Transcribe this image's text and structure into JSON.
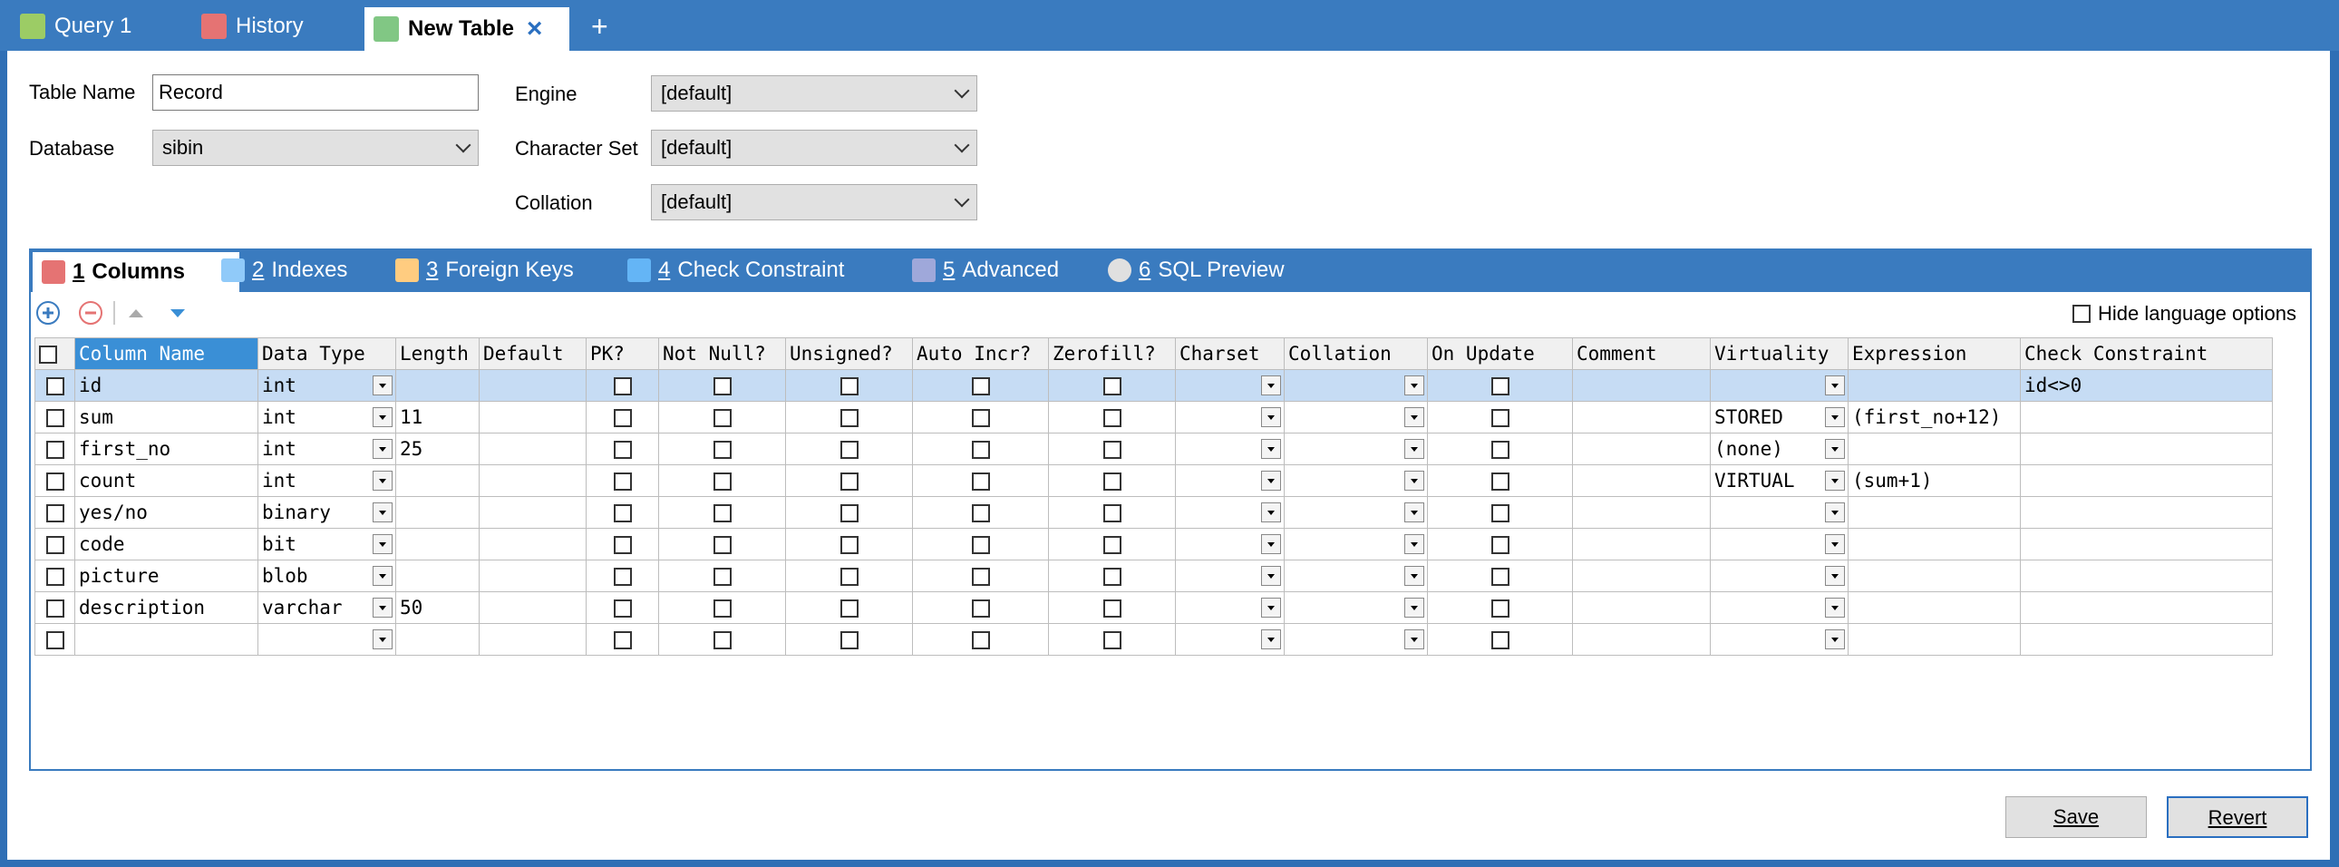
{
  "tabs": [
    {
      "label": "Query 1"
    },
    {
      "label": "History"
    },
    {
      "label": "New Table"
    }
  ],
  "add_tab_symbol": "+",
  "close_symbol": "×",
  "form": {
    "table_name_label": "Table Name",
    "table_name_value": "Record",
    "database_label": "Database",
    "database_value": "sibin",
    "engine_label": "Engine",
    "engine_value": "[default]",
    "charset_label": "Character Set",
    "charset_value": "[default]",
    "collation_label": "Collation",
    "collation_value": "[default]"
  },
  "inner_tabs": [
    {
      "num": "1",
      "label": "Columns"
    },
    {
      "num": "2",
      "label": "Indexes"
    },
    {
      "num": "3",
      "label": "Foreign Keys"
    },
    {
      "num": "4",
      "label": "Check Constraint"
    },
    {
      "num": "5",
      "label": "Advanced"
    },
    {
      "num": "6",
      "label": "SQL Preview"
    }
  ],
  "hide_language_label": "Hide language options",
  "headers": [
    "Column Name",
    "Data Type",
    "Length",
    "Default",
    "PK?",
    "Not Null?",
    "Unsigned?",
    "Auto Incr?",
    "Zerofill?",
    "Charset",
    "Collation",
    "On Update",
    "Comment",
    "Virtuality",
    "Expression",
    "Check Constraint"
  ],
  "rows": [
    {
      "name": "id",
      "type": "int",
      "length": "",
      "virtuality": "",
      "expression": "",
      "check": "id<>0"
    },
    {
      "name": "sum",
      "type": "int",
      "length": "11",
      "virtuality": "STORED",
      "expression": "(first_no+12)",
      "check": ""
    },
    {
      "name": "first_no",
      "type": "int",
      "length": "25",
      "virtuality": "(none)",
      "expression": "",
      "check": ""
    },
    {
      "name": "count",
      "type": "int",
      "length": "",
      "virtuality": "VIRTUAL",
      "expression": "(sum+1)",
      "check": ""
    },
    {
      "name": "yes/no",
      "type": "binary",
      "length": "",
      "virtuality": "",
      "expression": "",
      "check": ""
    },
    {
      "name": "code",
      "type": "bit",
      "length": "",
      "virtuality": "",
      "expression": "",
      "check": ""
    },
    {
      "name": "picture",
      "type": "blob",
      "length": "",
      "virtuality": "",
      "expression": "",
      "check": ""
    },
    {
      "name": "description",
      "type": "varchar",
      "length": "50",
      "virtuality": "",
      "expression": "",
      "check": ""
    },
    {
      "name": "",
      "type": "",
      "length": "",
      "virtuality": "",
      "expression": "",
      "check": ""
    }
  ],
  "buttons": {
    "save": "Save",
    "revert": "Revert"
  },
  "colors": {
    "accent": "#3a7bbf",
    "header_selected": "#3a8fd6",
    "row_selected": "#c6dcf4"
  }
}
